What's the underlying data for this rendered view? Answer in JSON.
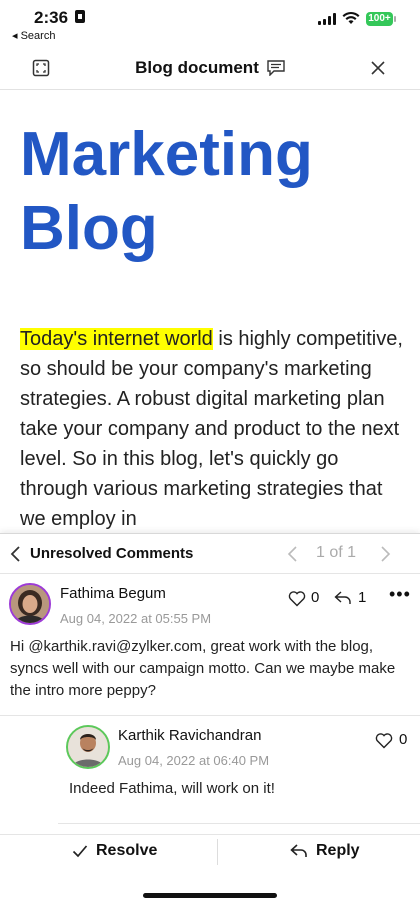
{
  "status": {
    "time": "2:36",
    "back_label": "◂ Search",
    "battery": "100+"
  },
  "topbar": {
    "title": "Blog document"
  },
  "document": {
    "title_line1": "Marketing",
    "title_line2": "Blog",
    "highlighted": "Today's internet world",
    "body": " is highly competitive, so should be your company's marketing strategies. A robust digital marketing plan take your company and product to the next level. So in this blog, let's quickly go through various marketing strategies that we employ in"
  },
  "comments_panel": {
    "title": "Unresolved Comments",
    "counter": "1 of 1",
    "comment": {
      "author": "Fathima Begum",
      "date": "Aug 04, 2022 at 05:55 PM",
      "likes": "0",
      "replies": "1",
      "text": "Hi @karthik.ravi@zylker.com, great work with the blog, syncs well with our campaign motto. Can we maybe make the intro more peppy?"
    },
    "reply": {
      "author": "Karthik Ravichandran",
      "date": "Aug 04, 2022 at 06:40 PM",
      "likes": "0",
      "text": "Indeed Fathima, will work on it!"
    },
    "actions": {
      "resolve": "Resolve",
      "reply": "Reply"
    }
  },
  "colors": {
    "accent": "#2257c4",
    "highlight": "#ffff00",
    "avatar_ring_1": "#9d3bd6",
    "avatar_ring_2": "#5bc95b"
  },
  "icons": [
    "expand-icon",
    "comment-icon",
    "close-icon",
    "back-icon",
    "prev-icon",
    "next-icon",
    "heart-icon",
    "reply-icon",
    "more-icon",
    "check-icon"
  ]
}
